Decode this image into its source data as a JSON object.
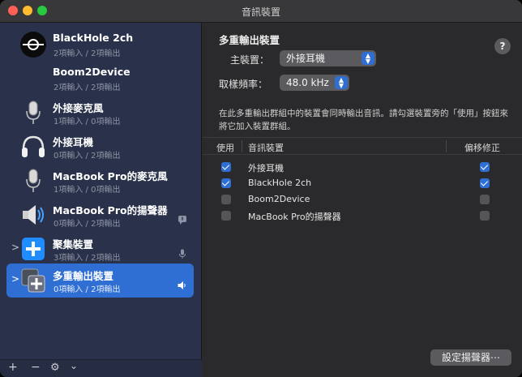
{
  "window": {
    "title": "音訊裝置"
  },
  "sidebar": {
    "devices": [
      {
        "name": "BlackHole 2ch",
        "io": "2項輸入 / 2項輸出",
        "icon": "blackhole-icon"
      },
      {
        "name": "Boom2Device",
        "io": "2項輸入 / 2項輸出",
        "icon": "none"
      },
      {
        "name": "外接麥克風",
        "io": "1項輸入 / 0項輸出",
        "icon": "microphone-icon"
      },
      {
        "name": "外接耳機",
        "io": "0項輸入 / 2項輸出",
        "icon": "headphones-icon"
      },
      {
        "name": "MacBook Pro的麥克風",
        "io": "1項輸入 / 0項輸出",
        "icon": "microphone-icon"
      },
      {
        "name": "MacBook Pro的揚聲器",
        "io": "0項輸入 / 2項輸出",
        "icon": "speaker-icon",
        "badge": "alert-bubble-icon"
      },
      {
        "name": "聚集裝置",
        "io": "3項輸入 / 2項輸出",
        "icon": "aggregate-plus-icon",
        "badge": "mic-small-icon",
        "disclosure": ">"
      },
      {
        "name": "多重輸出裝置",
        "io": "0項輸入 / 2項輸出",
        "icon": "multi-output-icon",
        "badge": "volume-small-icon",
        "disclosure": ">",
        "selected": true
      }
    ],
    "bottom_bar": {
      "add": "+",
      "remove": "−",
      "gear": "⚙",
      "chevron": "⌄"
    }
  },
  "main": {
    "heading": "多重輸出裝置",
    "help": "?",
    "primary_label": "主裝置：",
    "primary_value": "外接耳機",
    "sample_label": "取樣頻率：",
    "sample_value": "48.0 kHz",
    "description": "在此多重輸出群組中的裝置會同時輸出音訊。請勾選裝置旁的「使用」按鈕來將它加入裝置群組。",
    "table": {
      "headers": {
        "use": "使用",
        "device": "音訊裝置",
        "drift": "偏移修正"
      },
      "rows": [
        {
          "name": "外接耳機",
          "use": true,
          "drift": true
        },
        {
          "name": "BlackHole 2ch",
          "use": true,
          "drift": true
        },
        {
          "name": "Boom2Device",
          "use": false,
          "drift": false
        },
        {
          "name": "MacBook Pro的揚聲器",
          "use": false,
          "drift": false
        }
      ]
    },
    "configure_button": "設定揚聲器⋯"
  },
  "colors": {
    "accent": "#2f6fd3",
    "sidebar": "#29324a",
    "panel": "#2a2a2c"
  }
}
